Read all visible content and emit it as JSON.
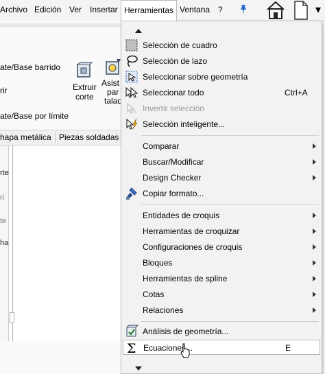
{
  "menubar": {
    "items": [
      "Archivo",
      "Edición",
      "Ver",
      "Insertar",
      "Herramientas",
      "Ventana",
      "?"
    ]
  },
  "ribbon": {
    "labels": [
      "ate/Base barrido",
      "rir",
      "ate/Base por límite"
    ],
    "extrude": [
      "Extruir",
      "corte"
    ],
    "wizard": [
      "Asist",
      "par",
      "talad"
    ]
  },
  "tabs": [
    "hapa metálica",
    "Piezas soldadas"
  ],
  "leftpanel": [
    "rte",
    "ri",
    "te",
    "ha"
  ],
  "menu": {
    "items": [
      {
        "label": "Selección de cuadro",
        "icon": "box-select-icon"
      },
      {
        "label": "Selección de lazo",
        "icon": "lasso-icon"
      },
      {
        "label": "Seleccionar sobre geometría",
        "icon": "select-over-geometry-icon"
      },
      {
        "label": "Seleccionar todo",
        "shortcut": "Ctrl+A",
        "icon": "select-all-icon"
      },
      {
        "label": "Invertir selección",
        "icon": "invert-selection-icon",
        "disabled": true
      },
      {
        "label": "Selección inteligente...",
        "icon": "smart-select-icon"
      },
      {
        "label": "Comparar",
        "submenu": true
      },
      {
        "label": "Buscar/Modificar",
        "submenu": true
      },
      {
        "label": "Design Checker",
        "submenu": true
      },
      {
        "label": "Copiar formato...",
        "icon": "format-painter-icon"
      },
      {
        "label": "Entidades de croquis",
        "submenu": true
      },
      {
        "label": "Herramientas de croquizar",
        "submenu": true
      },
      {
        "label": "Configuraciones de croquis",
        "submenu": true
      },
      {
        "label": "Bloques",
        "submenu": true
      },
      {
        "label": "Herramientas de spline",
        "submenu": true
      },
      {
        "label": "Cotas",
        "submenu": true
      },
      {
        "label": "Relaciones",
        "submenu": true
      },
      {
        "label": "Análisis de geometría...",
        "icon": "geometry-analysis-icon"
      },
      {
        "label": "Ecuaciones...",
        "shortcut": "E",
        "icon": "sigma-icon",
        "highlighted": true
      }
    ]
  }
}
